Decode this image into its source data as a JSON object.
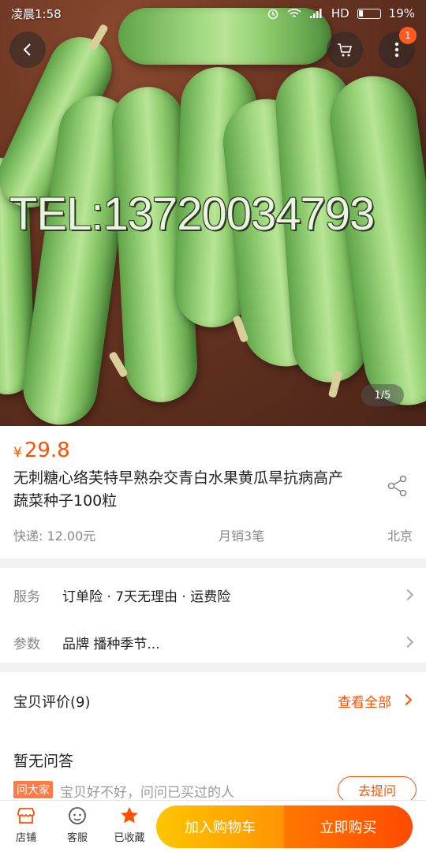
{
  "status_bar": {
    "time": "凌晨1:58",
    "network": "HD",
    "battery": "19%"
  },
  "gallery": {
    "watermark": "TEL:13720034793",
    "counter": "1/5",
    "menu_badge": "1"
  },
  "product": {
    "currency": "¥",
    "price": "29.8",
    "title": "无刺糖心络芙特早熟杂交青白水果黄瓜旱抗病高产蔬菜种子100粒",
    "shipping": "快递: 12.00元",
    "monthly_sales": "月销3笔",
    "location": "北京"
  },
  "service": {
    "label": "服务",
    "value": "订单险 · 7天无理由 · 运费险"
  },
  "params": {
    "label": "参数",
    "value": "品牌 播种季节..."
  },
  "reviews": {
    "title": "宝贝评价(9)",
    "view_all": "查看全部"
  },
  "qa": {
    "title": "暂无问答",
    "tag": "问大家",
    "hint": "宝贝好不好，问问已买过的人",
    "ask_button": "去提问"
  },
  "bottom_bar": {
    "store": "店铺",
    "service": "客服",
    "favorite": "已收藏",
    "add_to_cart": "加入购物车",
    "buy_now": "立即购买"
  },
  "colors": {
    "accent": "#ff5000",
    "cart_gradient": [
      "#ffc500",
      "#ff9402"
    ],
    "buy_gradient": [
      "#ff7700",
      "#ff4a00"
    ]
  }
}
